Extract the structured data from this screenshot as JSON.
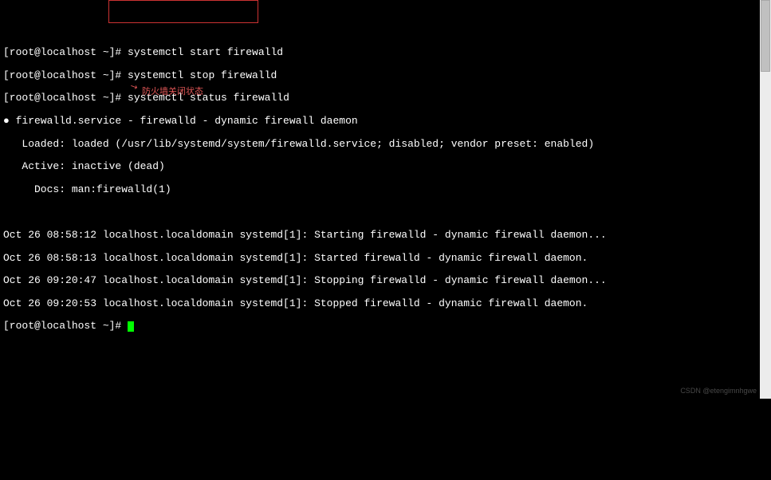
{
  "prompts": {
    "p1_prefix": "[root@localhost ~]# ",
    "p1_cmd": "systemctl start firewalld",
    "p2_prefix": "[root@localhost ~]# ",
    "p2_cmd": "systemctl stop firewalld",
    "p3_prefix": "[root@localhost ~]# ",
    "p3_cmd": "systemctl status firewalld",
    "p4_prefix": "[root@localhost ~]# "
  },
  "status": {
    "header": "● firewalld.service - firewalld - dynamic firewall daemon",
    "loaded": "   Loaded: loaded (/usr/lib/systemd/system/firewalld.service; disabled; vendor preset: enabled)",
    "active": "   Active: inactive (dead)",
    "docs": "     Docs: man:firewalld(1)"
  },
  "logs": {
    "l1": "Oct 26 08:58:12 localhost.localdomain systemd[1]: Starting firewalld - dynamic firewall daemon...",
    "l2": "Oct 26 08:58:13 localhost.localdomain systemd[1]: Started firewalld - dynamic firewall daemon.",
    "l3": "Oct 26 09:20:47 localhost.localdomain systemd[1]: Stopping firewalld - dynamic firewall daemon...",
    "l4": "Oct 26 09:20:53 localhost.localdomain systemd[1]: Stopped firewalld - dynamic firewall daemon."
  },
  "annotation": {
    "text": "防火墙关闭状态",
    "arrow": "↘"
  },
  "watermark": "CSDN @etengimnhgwe"
}
